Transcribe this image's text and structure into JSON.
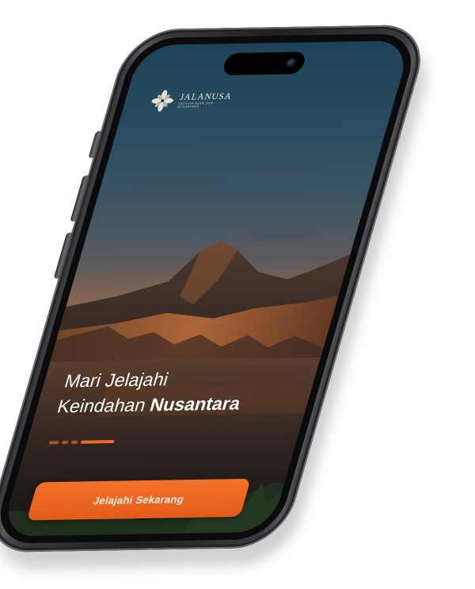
{
  "app": {
    "brand_name": "JALANUSA",
    "brand_tagline": "JELAJAH ALAM DAN NUSANTARA"
  },
  "hero": {
    "line1": "Mari Jelajahi",
    "line2_light": "Keindahan ",
    "line2_bold": "Nusantara"
  },
  "pager": {
    "total": 4,
    "active_index": 3
  },
  "cta": {
    "label": "Jelajahi Sekarang"
  },
  "colors": {
    "accent": "#ee6a24",
    "pager_inactive": "#b8531f",
    "text": "#ffffff"
  },
  "icons": {
    "logo": "leaf-flower-logo-icon"
  }
}
